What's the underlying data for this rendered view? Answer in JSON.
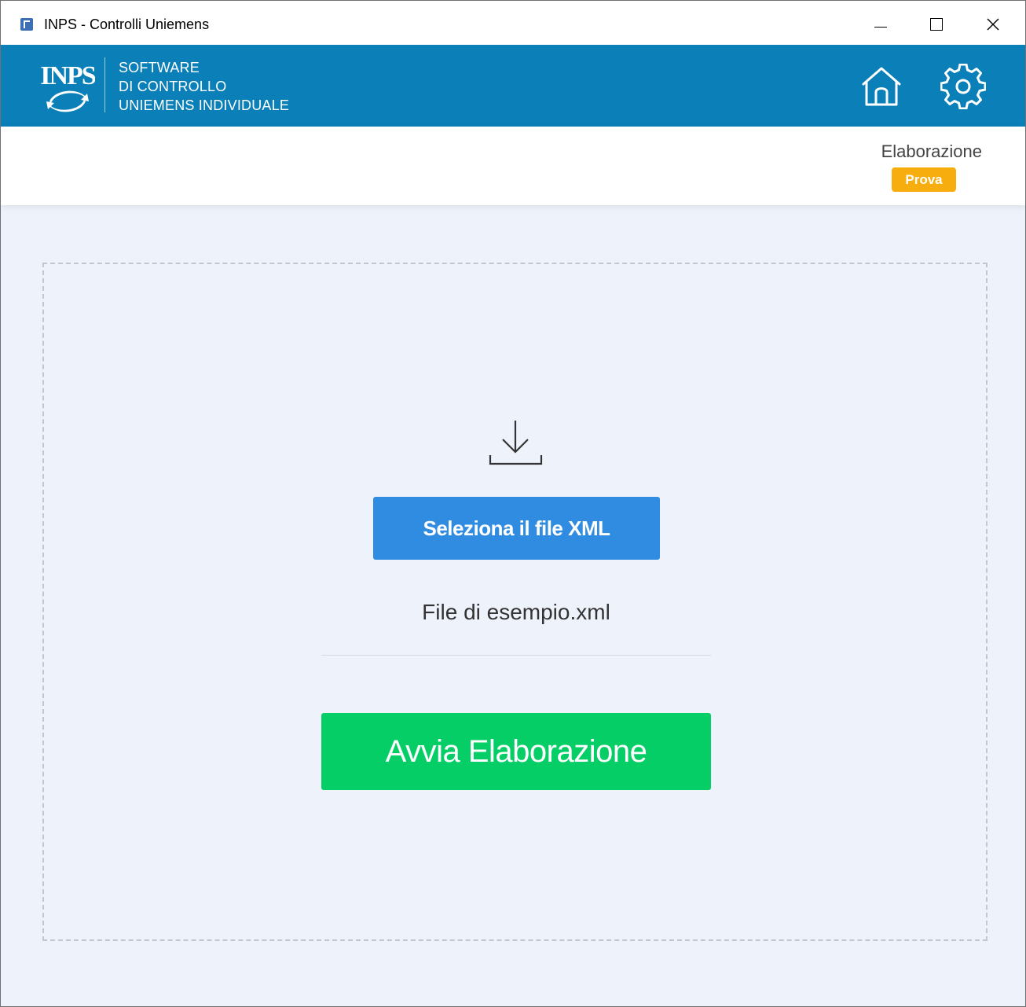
{
  "window": {
    "title": "INPS - Controlli Uniemens"
  },
  "header": {
    "logo_text": "INPS",
    "subtitle_line1": "SOFTWARE",
    "subtitle_line2": "DI CONTROLLO",
    "subtitle_line3": "UNIEMENS INDIVIDUALE",
    "icons": [
      "home-icon",
      "gear-icon"
    ]
  },
  "info": {
    "mode_label": "Elaborazione",
    "mode_badge": "Prova"
  },
  "main": {
    "select_button": "Seleziona il file XML",
    "file_name": "File di esempio.xml",
    "start_button": "Avvia Elaborazione"
  },
  "colors": {
    "header_bg": "#0a7fb8",
    "badge": "#f7ad0e",
    "select_button": "#2f8ce0",
    "start_button": "#05ce67",
    "content_bg": "#eef3fb"
  }
}
